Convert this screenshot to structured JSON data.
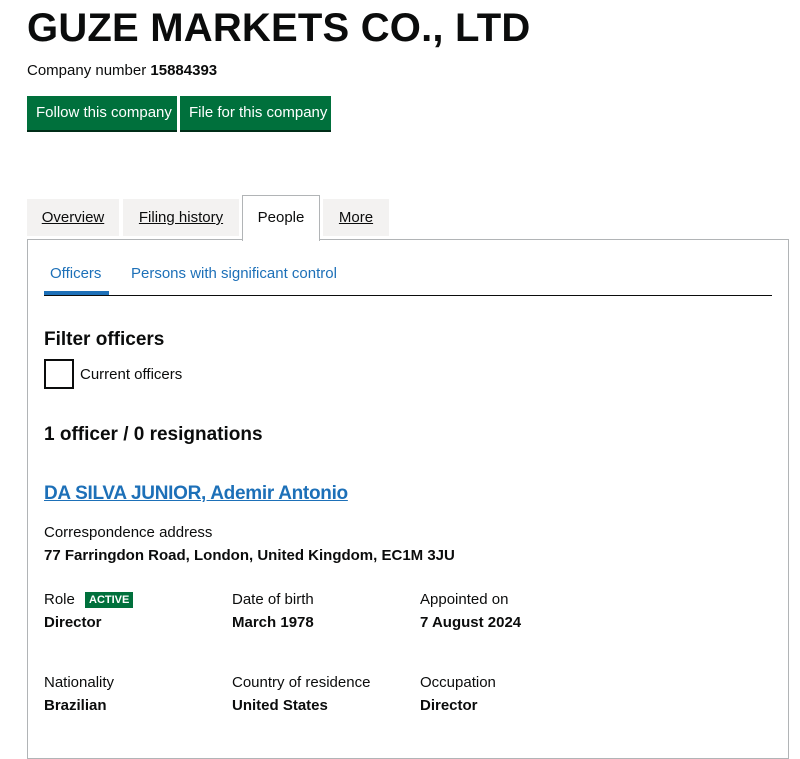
{
  "company": {
    "name": "GUZE MARKETS CO., LTD",
    "number_label": "Company number",
    "number": "15884393"
  },
  "actions": {
    "follow_label": "Follow this company",
    "file_label": "File for this company"
  },
  "tabs": [
    {
      "label": "Overview",
      "selected": false
    },
    {
      "label": "Filing history",
      "selected": false
    },
    {
      "label": "People",
      "selected": true
    },
    {
      "label": "More",
      "selected": false
    }
  ],
  "subtabs": [
    {
      "label": "Officers",
      "selected": true
    },
    {
      "label": "Persons with significant control",
      "selected": false
    }
  ],
  "filter": {
    "heading": "Filter officers",
    "checkbox_label": "Current officers",
    "checked": false
  },
  "summary": "1 officer / 0 resignations",
  "officer": {
    "name": "DA SILVA JUNIOR, Ademir Antonio",
    "address_label": "Correspondence address",
    "address": "77 Farringdon Road, London, United Kingdom, EC1M 3JU",
    "role_label": "Role",
    "status": "ACTIVE",
    "role": "Director",
    "dob_label": "Date of birth",
    "dob": "March 1978",
    "appointed_label": "Appointed on",
    "appointed": "7 August 2024",
    "nationality_label": "Nationality",
    "nationality": "Brazilian",
    "residence_label": "Country of residence",
    "residence": "United States",
    "occupation_label": "Occupation",
    "occupation": "Director"
  },
  "colors": {
    "primary_green": "#00703c",
    "link_blue": "#1d70b8",
    "text": "#0b0c0c",
    "tab_bg": "#f3f2f1",
    "border": "#b1b4b6"
  }
}
